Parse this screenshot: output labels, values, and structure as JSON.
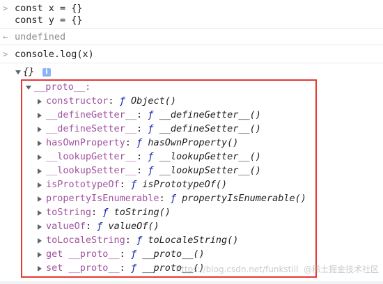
{
  "inputs": [
    {
      "line1": "const x = {}",
      "line2": "const y = {}"
    },
    {
      "text": "console.log(x)"
    }
  ],
  "result_undefined": "undefined",
  "object_label": "{}",
  "info_icon": "i",
  "proto_header": "__proto__:",
  "properties": [
    {
      "key": "constructor",
      "fn": "Object()"
    },
    {
      "key": "__defineGetter__",
      "fn": "__defineGetter__()"
    },
    {
      "key": "__defineSetter__",
      "fn": "__defineSetter__()"
    },
    {
      "key": "hasOwnProperty",
      "fn": "hasOwnProperty()"
    },
    {
      "key": "__lookupGetter__",
      "fn": "__lookupGetter__()"
    },
    {
      "key": "__lookupSetter__",
      "fn": "__lookupSetter__()"
    },
    {
      "key": "isPrototypeOf",
      "fn": "isPrototypeOf()"
    },
    {
      "key": "propertyIsEnumerable",
      "fn": "propertyIsEnumerable()"
    },
    {
      "key": "toString",
      "fn": "toString()"
    },
    {
      "key": "valueOf",
      "fn": "valueOf()"
    },
    {
      "key": "toLocaleString",
      "fn": "toLocaleString()"
    },
    {
      "key": "get __proto__",
      "fn": "__proto__()"
    },
    {
      "key": "set __proto__",
      "fn": "__proto__()"
    }
  ],
  "f_glyph": "ƒ",
  "watermark": "https://blog.csdn.net/funkstill  @稀土掘金技术社区",
  "colors": {
    "key": "#881280",
    "fn": "#0d22aa",
    "highlight_border": "#e53935",
    "info_icon": "#8ab4f8"
  }
}
